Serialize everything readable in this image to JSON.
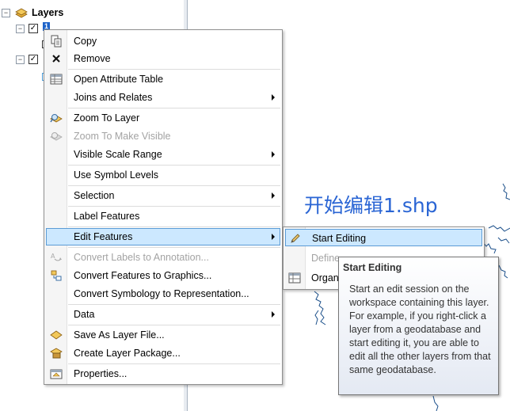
{
  "toc": {
    "root_label": "Layers",
    "layer1_badge": "1",
    "checked_mark": "✓",
    "collapse_glyph": "−"
  },
  "map": {
    "annotation_text": "开始编辑1.shp",
    "line_color": "#1b4f8a"
  },
  "context_menu": {
    "items": [
      {
        "label": "Copy",
        "icon": "copy-icon",
        "enabled": true
      },
      {
        "label": "Remove",
        "icon": "remove-icon",
        "enabled": true
      },
      {
        "label": "Open Attribute Table",
        "icon": "table-icon",
        "enabled": true
      },
      {
        "label": "Joins and Relates",
        "icon": "",
        "enabled": true,
        "submenu": true
      },
      {
        "label": "Zoom To Layer",
        "icon": "zoom-layer-icon",
        "enabled": true
      },
      {
        "label": "Zoom To Make Visible",
        "icon": "zoom-visible-icon",
        "enabled": false
      },
      {
        "label": "Visible Scale Range",
        "icon": "",
        "enabled": true,
        "submenu": true
      },
      {
        "label": "Use Symbol Levels",
        "icon": "",
        "enabled": true
      },
      {
        "label": "Selection",
        "icon": "",
        "enabled": true,
        "submenu": true
      },
      {
        "label": "Label Features",
        "icon": "",
        "enabled": true
      },
      {
        "label": "Edit Features",
        "icon": "",
        "enabled": true,
        "submenu": true,
        "highlighted": true
      },
      {
        "label": "Convert Labels to Annotation...",
        "icon": "convert-labels-icon",
        "enabled": false
      },
      {
        "label": "Convert Features to Graphics...",
        "icon": "convert-graphics-icon",
        "enabled": true
      },
      {
        "label": "Convert Symbology to Representation...",
        "icon": "",
        "enabled": true
      },
      {
        "label": "Data",
        "icon": "",
        "enabled": true,
        "submenu": true
      },
      {
        "label": "Save As Layer File...",
        "icon": "layer-file-icon",
        "enabled": true
      },
      {
        "label": "Create Layer Package...",
        "icon": "layer-package-icon",
        "enabled": true
      },
      {
        "label": "Properties...",
        "icon": "properties-icon",
        "enabled": true
      }
    ]
  },
  "edit_submenu": {
    "items": [
      {
        "label": "Start Editing",
        "icon": "pencil-icon",
        "highlighted": true
      },
      {
        "label": "Define",
        "enabled": false
      },
      {
        "label": "Organ",
        "icon": "organize-icon"
      }
    ]
  },
  "tooltip": {
    "title": "Start Editing",
    "body": "Start an edit session on the workspace containing this layer. For example, if you right-click a layer from a geodatabase and start editing it, you are able to edit all the other layers from that same geodatabase."
  }
}
